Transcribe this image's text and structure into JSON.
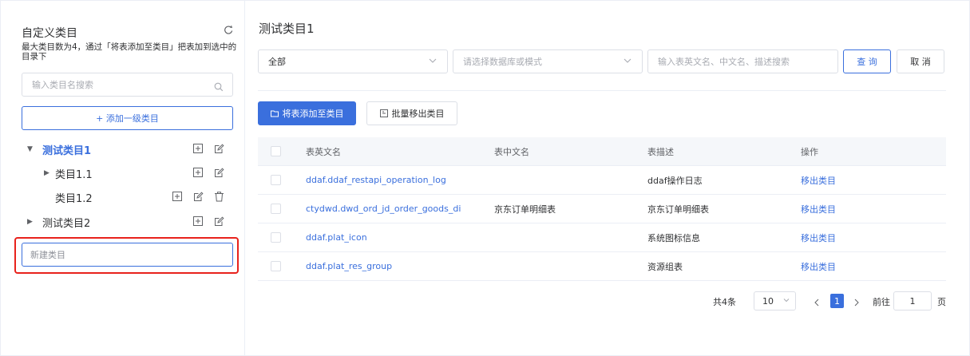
{
  "sidebar": {
    "title": "自定义类目",
    "hint": "最大类目数为4，通过「将表添加至类目」把表加到选中的目录下",
    "search_placeholder": "输入类目名搜索",
    "add_top_label": "+ 添加一级类目",
    "tree": [
      {
        "label": "测试类目1",
        "expanded": true,
        "active": true
      },
      {
        "label": "类目1.1",
        "expanded": false
      },
      {
        "label": "类目1.2"
      },
      {
        "label": "测试类目2",
        "expanded": false
      }
    ],
    "new_category_placeholder": "新建类目"
  },
  "main": {
    "title": "测试类目1",
    "filter_scope": "全部",
    "filter_db_placeholder": "请选择数据库或模式",
    "filter_search_placeholder": "输入表英文名、中文名、描述搜索",
    "query_label": "查 询",
    "cancel_label": "取 消",
    "add_to_category_label": "将表添加至类目",
    "batch_remove_label": "批量移出类目",
    "columns": [
      "表英文名",
      "表中文名",
      "表描述",
      "操作"
    ],
    "rows": [
      {
        "en": "ddaf.ddaf_restapi_operation_log",
        "cn": "",
        "desc": "ddaf操作日志",
        "op": "移出类目"
      },
      {
        "en": "ctydwd.dwd_ord_jd_order_goods_di",
        "cn": "京东订单明细表",
        "desc": "京东订单明细表",
        "op": "移出类目"
      },
      {
        "en": "ddaf.plat_icon",
        "cn": "",
        "desc": "系统图标信息",
        "op": "移出类目"
      },
      {
        "en": "ddaf.plat_res_group",
        "cn": "",
        "desc": "资源组表",
        "op": "移出类目"
      }
    ],
    "pagination": {
      "total": "共4条",
      "page_size": "10",
      "current_page": "1",
      "goto_label": "前往",
      "goto_value": "1",
      "page_suffix": "页"
    }
  },
  "colors": {
    "primary": "#3a6fdd",
    "highlight": "#e8221c"
  }
}
